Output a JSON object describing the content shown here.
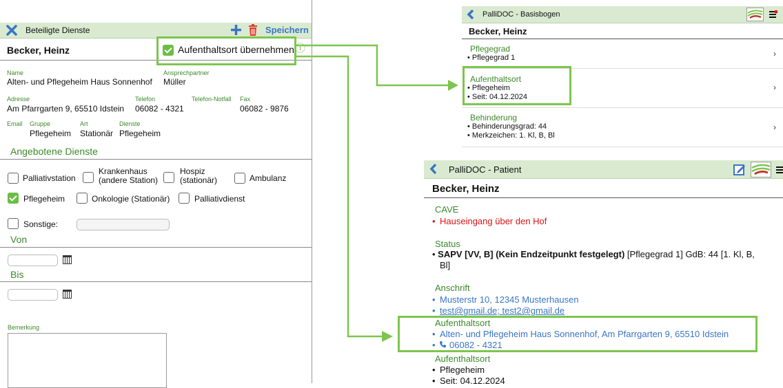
{
  "left": {
    "toolbar": {
      "title": "Beteiligte Dienste",
      "save_label": "Speichern"
    },
    "patient_name": "Becker, Heinz",
    "aufenthalt_checkbox_label": "Aufenthaltsort übernehmen",
    "info_icon": "ⓘ",
    "fields": {
      "name_label": "Name",
      "name_value": "Alten- und Pflegeheim Haus Sonnenhof",
      "ansprech_label": "Ansprechpartner",
      "ansprech_value": "Müller",
      "adresse_label": "Adresse",
      "adresse_value": "Am Pfarrgarten 9, 65510 Idstein",
      "telefon_label": "Telefon",
      "telefon_value": "06082 - 4321",
      "notfall_label": "Telefon-Notfall",
      "fax_label": "Fax",
      "fax_value": "06082 - 9876",
      "email_label": "Email",
      "gruppe_label": "Gruppe",
      "gruppe_value": "Pflegeheim",
      "art_label": "Art",
      "art_value": "Stationär",
      "dienste_label": "Dienste",
      "dienste_value": "Pflegeheim"
    },
    "angebotene_title": "Angebotene Dienste",
    "services": {
      "palliativstation": "Palliativstation",
      "krankenhaus_1": "Krankenhaus",
      "krankenhaus_2": "(andere Station)",
      "hospiz_1": "Hospiz",
      "hospiz_2": "(stationär)",
      "ambulanz": "Ambulanz",
      "pflegeheim": "Pflegeheim",
      "onkologie": "Onkologie (Stationär)",
      "palliativdienst": "Palliativdienst",
      "sonstige": "Sonstige:"
    },
    "von_label": "Von",
    "bis_label": "Bis",
    "bemerkung_label": "Bemerkung"
  },
  "basisbogen": {
    "title": "PalliDOC - Basisbogen",
    "patient_name": "Becker, Heinz",
    "items": [
      {
        "title": "Pflegegrad",
        "lines": [
          "• Pflegegrad 1"
        ]
      },
      {
        "title": "Aufenthaltsort",
        "lines": [
          "• Pflegeheim",
          "• Seit: 04.12.2024"
        ]
      },
      {
        "title": "Behinderung",
        "lines": [
          "• Behinderungsgrad: 44",
          "• Merkzeichen: 1. Kl, B, Bl"
        ]
      }
    ]
  },
  "patient": {
    "title": "PalliDOC - Patient",
    "patient_name": "Becker, Heinz",
    "cave_title": "CAVE",
    "cave_line": "Hauseingang über den Hof",
    "status_title": "Status",
    "status_bold": "SAPV [VV, B] (Kein Endzeitpunkt festgelegt)",
    "status_rest": " [Pflegegrad 1] GdB: 44 [1. Kl, B,",
    "status_line2": "Bl]",
    "anschrift_title": "Anschrift",
    "anschrift_addr": "Musterstr 10, 12345 Musterhausen",
    "anschrift_email": "test@gmail.de; test2@gmail.de",
    "aufenthalt1_title": "Aufenthaltsort",
    "aufenthalt1_addr": "Alten- und Pflegeheim Haus Sonnenhof, Am Pfarrgarten 9, 65510 Idstein",
    "aufenthalt1_phone": "06082 - 4321",
    "aufenthalt2_title": "Aufenthaltsort",
    "aufenthalt2_line1": "Pflegeheim",
    "aufenthalt2_line2": "Seit: 04.12.2024"
  },
  "colors": {
    "accent_green": "#7dc54e",
    "toolbar_bg": "#d9ead0",
    "link_blue": "#3a75c4",
    "warning_red": "#d11111"
  }
}
